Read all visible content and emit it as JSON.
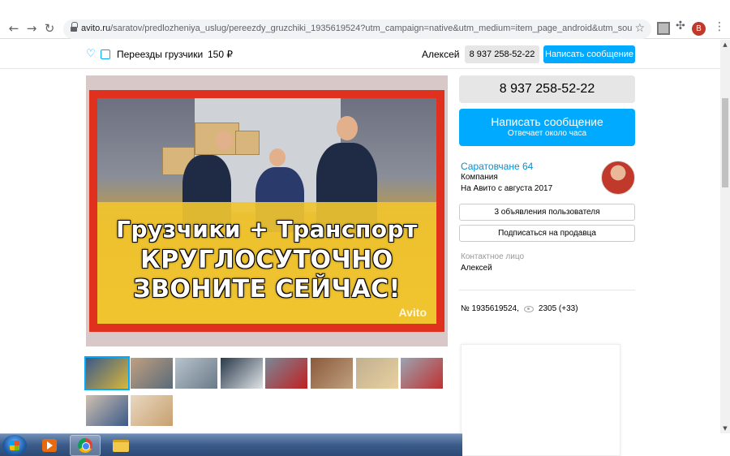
{
  "browser": {
    "url_host": "avito.ru",
    "url_rest": "/saratov/predlozheniya_uslug/pereezdy_gruzchiki_1935619524?utm_campaign=native&utm_medium=item_page_android&utm_source=soc_shari...",
    "profile_initial": "В"
  },
  "sticky_header": {
    "title": "Переезды грузчики",
    "price": "150 ₽",
    "user": "Алексей",
    "phone": "8 937 258-52-22",
    "message_button": "Написать сообщение"
  },
  "listing": {
    "banner_line1": "Грузчики + Транспорт",
    "banner_line2": "КРУГЛОСУТОЧНО",
    "banner_line3": "ЗВОНИТЕ СЕЙЧАС!",
    "watermark": "Avito",
    "thumbnails": [
      {
        "colors": [
          "#3a5a8a",
          "#d9b63a"
        ]
      },
      {
        "colors": [
          "#c0a080",
          "#5a6a7a"
        ]
      },
      {
        "colors": [
          "#b8c4cc",
          "#6a7a88"
        ]
      },
      {
        "colors": [
          "#2a3a4a",
          "#e0e4e8"
        ]
      },
      {
        "colors": [
          "#7a8898",
          "#c02020"
        ]
      },
      {
        "colors": [
          "#8a5a3a",
          "#c0a080"
        ]
      },
      {
        "colors": [
          "#c0b090",
          "#e8d0a0"
        ]
      },
      {
        "colors": [
          "#9aa4b0",
          "#c03030"
        ]
      },
      {
        "colors": [
          "#d0c0b0",
          "#3a5a8a"
        ]
      },
      {
        "colors": [
          "#e8d8c0",
          "#c8a070"
        ]
      }
    ]
  },
  "sidebar": {
    "phone": "8 937 258-52-22",
    "message_button": "Написать сообщение",
    "message_subtitle": "Отвечает около часа",
    "seller_name": "Саратовчане 64",
    "seller_type": "Компания",
    "seller_since": "На Авито с августа 2017",
    "user_ads_button": "3 объявления пользователя",
    "subscribe_button": "Подписаться на продавца",
    "contact_label": "Контактное лицо",
    "contact_name": "Алексей",
    "ad_number": "№ 1935619524,",
    "views": "2305 (+33)"
  },
  "colors": {
    "accent": "#00aaff",
    "link": "#0091d9",
    "banner_red": "#e0301e",
    "banner_yellow": "#f0c430"
  }
}
